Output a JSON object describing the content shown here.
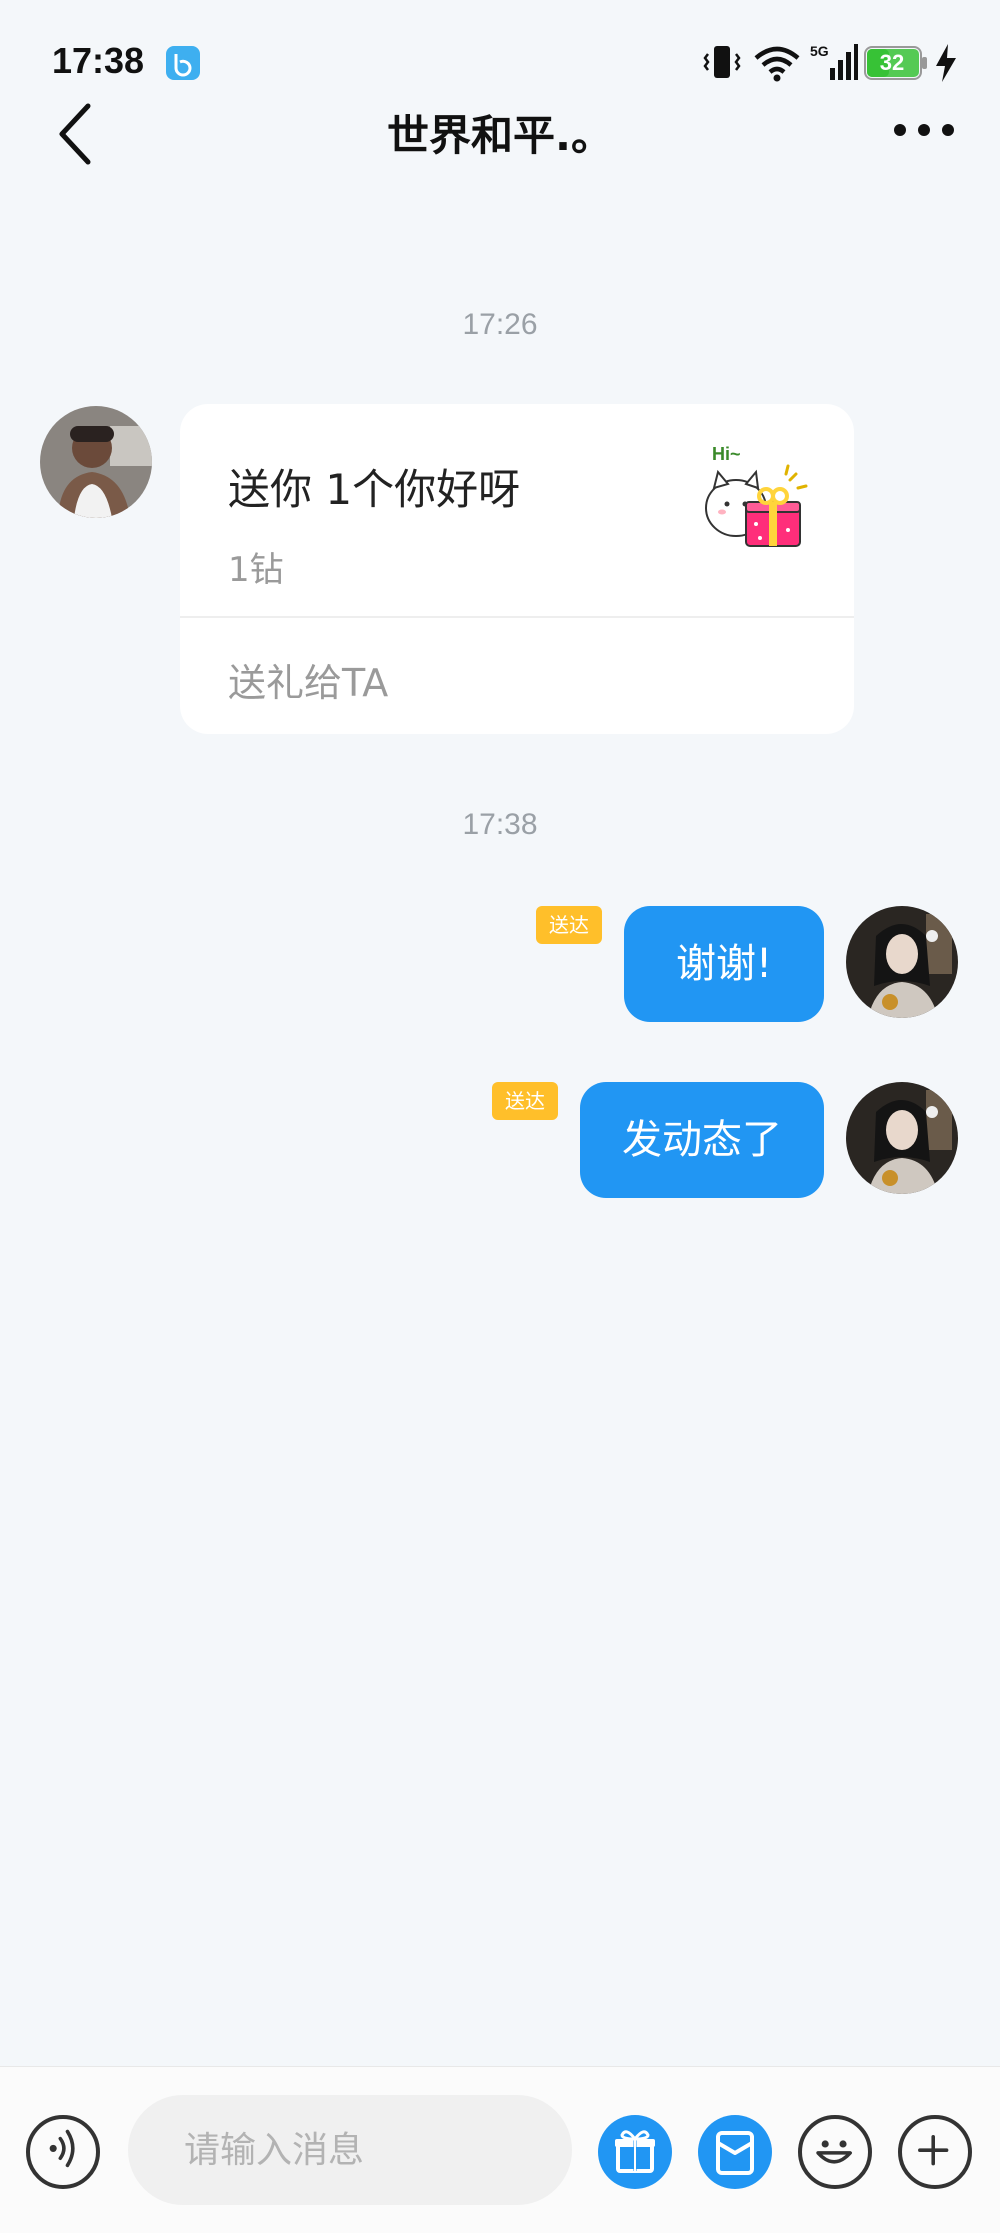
{
  "status_bar": {
    "time": "17:38",
    "network": "5G",
    "battery": "32"
  },
  "header": {
    "title": "世界和平.。"
  },
  "messages": {
    "time_1": "17:26",
    "gift_card": {
      "title": "送你 1个你好呀",
      "price": "1钻",
      "sticker_text": "Hi~",
      "send_gift_label": "送礼给TA"
    },
    "time_2": "17:38",
    "outgoing": [
      {
        "text": "谢谢!",
        "status": "送达"
      },
      {
        "text": "发动态了",
        "status": "送达"
      }
    ]
  },
  "composer": {
    "placeholder": "请输入消息"
  },
  "colors": {
    "accent": "#2196f3",
    "badge": "#ffbf2a",
    "background": "#f4f7fa"
  }
}
